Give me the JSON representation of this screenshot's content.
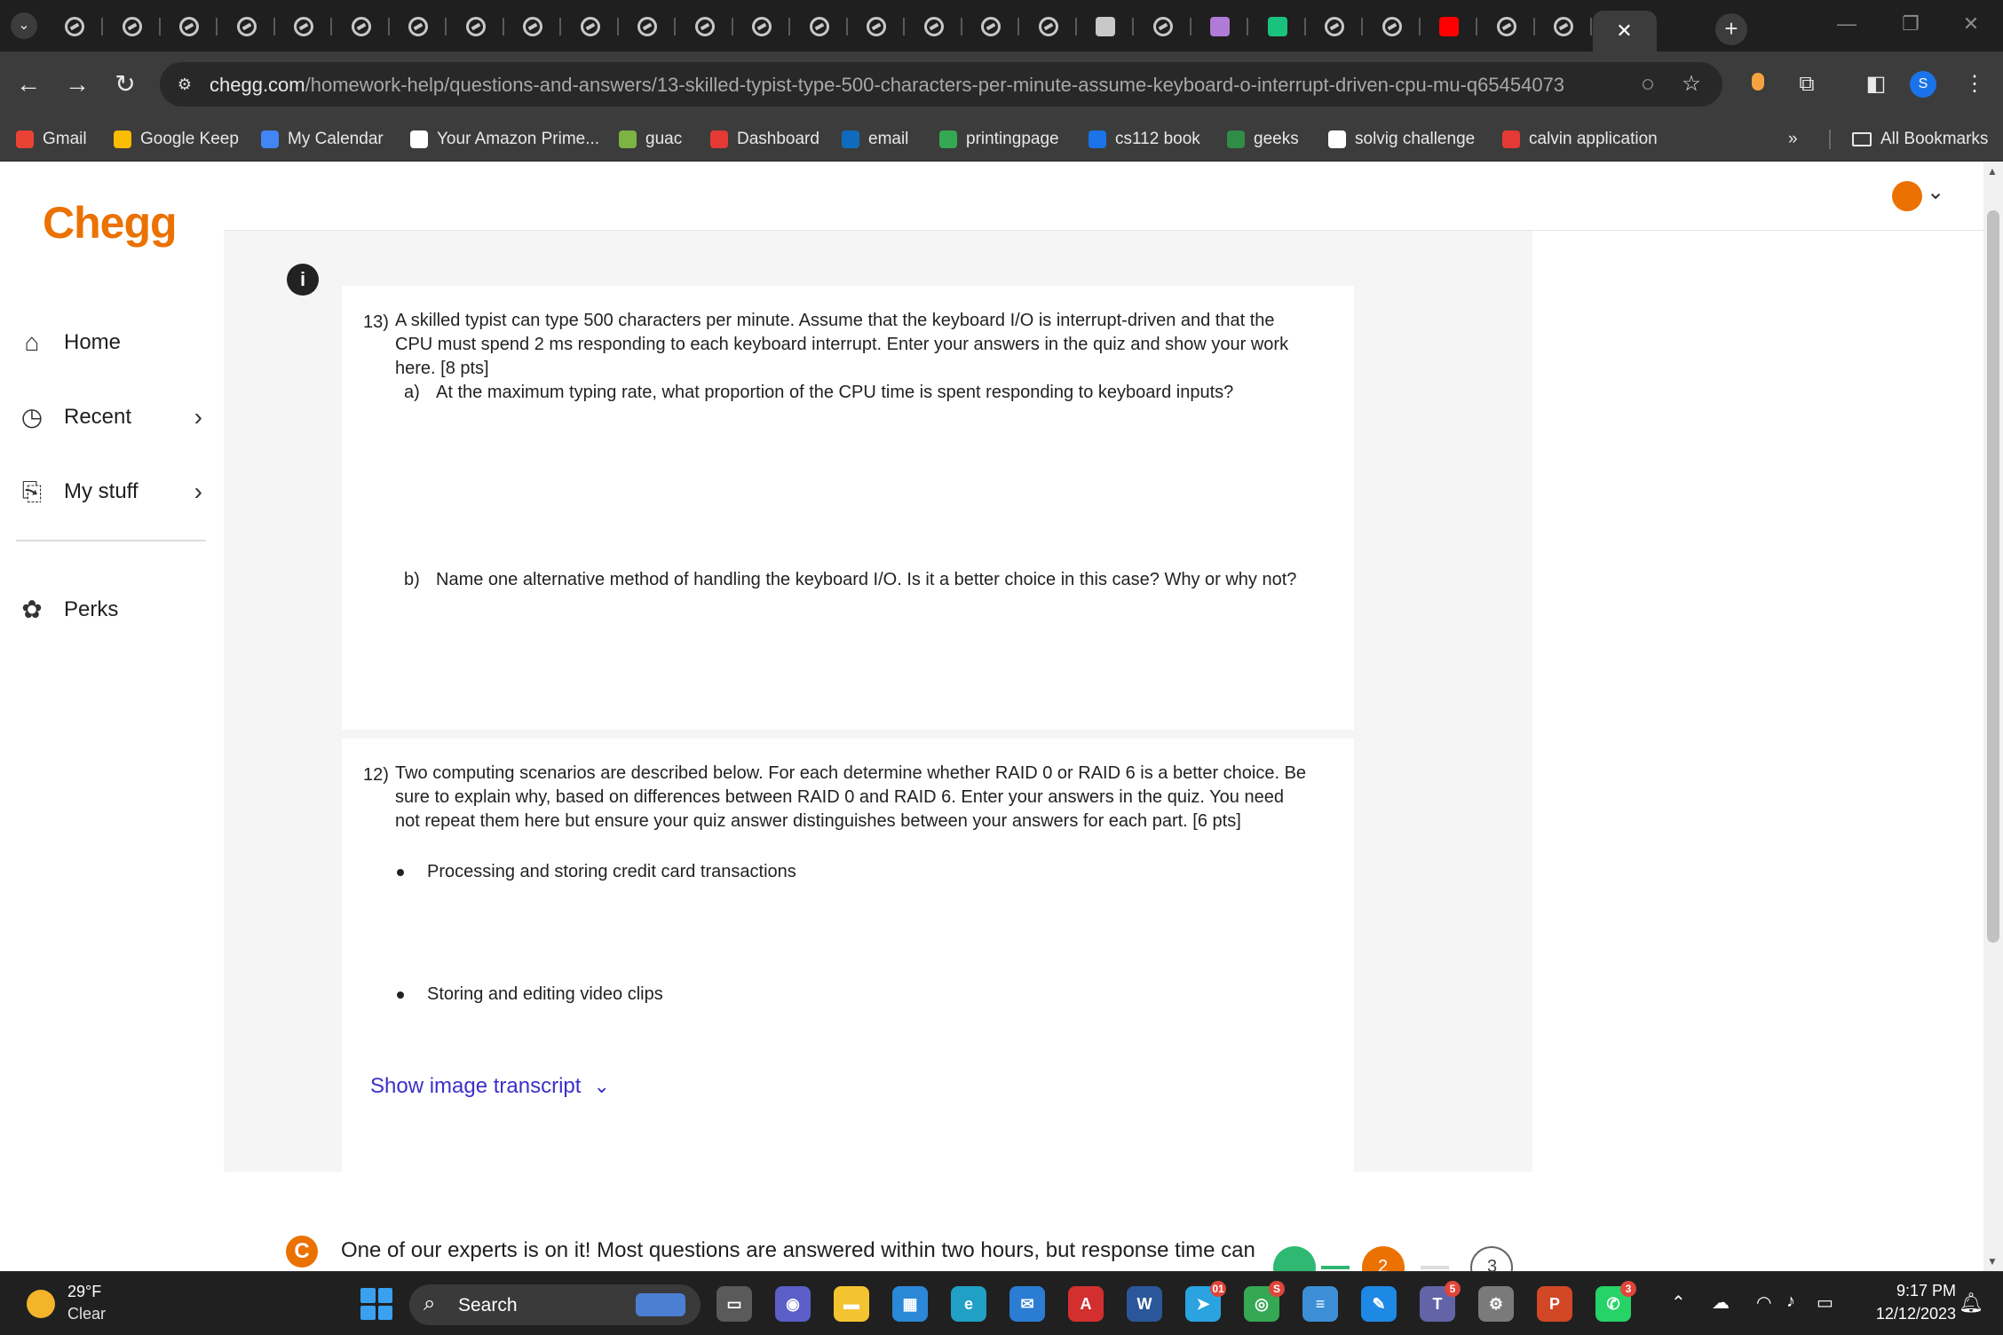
{
  "browser": {
    "tab_count": 27,
    "active_tab_close": "✕",
    "new_tab": "+",
    "url_host": "chegg.com",
    "url_path": "/homework-help/questions-and-answers/13-skilled-typist-type-500-characters-per-minute-assume-keyboard-o-interrupt-driven-cpu-mu-q65454073",
    "profile_initial": "S",
    "bookmarks": [
      {
        "label": "Gmail",
        "icon": "gmail-icon",
        "color": "#ea4335"
      },
      {
        "label": "Google Keep",
        "icon": "keep-icon",
        "color": "#fbbc04"
      },
      {
        "label": "My Calendar",
        "icon": "calendar-icon",
        "color": "#4285f4"
      },
      {
        "label": "Your Amazon Prime...",
        "icon": "amazon-icon",
        "color": "#ffffff"
      },
      {
        "label": "guac",
        "icon": "bowl-icon",
        "color": "#7cb342"
      },
      {
        "label": "Dashboard",
        "icon": "shield-icon",
        "color": "#e53935"
      },
      {
        "label": "email",
        "icon": "outlook-icon",
        "color": "#0f6cbd"
      },
      {
        "label": "printingpage",
        "icon": "flag-icon",
        "color": "#34a853"
      },
      {
        "label": "cs112 book",
        "icon": "book-icon",
        "color": "#1a73e8"
      },
      {
        "label": "geeks",
        "icon": "geeks-icon",
        "color": "#2f8d46"
      },
      {
        "label": "solvig challenge",
        "icon": "grid-icon",
        "color": "#ffffff"
      },
      {
        "label": "calvin application",
        "icon": "shield-icon",
        "color": "#e53935"
      }
    ],
    "bookmarks_overflow": "»",
    "all_bookmarks": "All Bookmarks"
  },
  "sidebar": {
    "logo": "Chegg",
    "items": [
      {
        "label": "Home",
        "icon": "home-icon",
        "has_chevron": false
      },
      {
        "label": "Recent",
        "icon": "clock-icon",
        "has_chevron": true
      },
      {
        "label": "My stuff",
        "icon": "bookmark-icon",
        "has_chevron": true
      },
      {
        "label": "Perks",
        "icon": "gift-icon",
        "has_chevron": false
      }
    ]
  },
  "question1": {
    "number": "13)",
    "lines": [
      "A skilled typist can type 500 characters per minute.  Assume that the keyboard I/O is interrupt-driven and that the",
      "CPU must spend 2 ms responding to each keyboard interrupt.  Enter your answers in the quiz and show your work",
      "here. [8 pts]"
    ],
    "part_a_label": "a)",
    "part_a": "At the maximum typing rate, what proportion of the CPU time is spent responding to keyboard inputs?",
    "part_b_label": "b)",
    "part_b": "Name one alternative method of handling the keyboard I/O.  Is it a better choice in this case?  Why or why not?"
  },
  "question2": {
    "number": "12)",
    "lines": [
      "Two computing scenarios are described below.  For each determine whether RAID 0 or RAID 6 is a better choice.  Be",
      "sure to explain why, based on differences between RAID 0 and RAID 6.  Enter your answers in the quiz.  You need",
      "not repeat them here but ensure your quiz answer distinguishes between your answers for each part. [6 pts]"
    ],
    "bullets": [
      "Processing and storing credit card transactions",
      "Storing and editing video clips"
    ]
  },
  "transcript_label": "Show image transcript",
  "expert_message": "One of our experts is on it! Most questions are answered within two hours, but response time can",
  "progress_steps": [
    "",
    "2",
    "3"
  ],
  "taskbar": {
    "temperature": "29°F",
    "weather": "Clear",
    "search_label": "Search",
    "apps": [
      {
        "name": "taskview-icon",
        "color": "#5a5a5a",
        "glyph": "▭",
        "badge": ""
      },
      {
        "name": "meet-icon",
        "color": "#5b5fc7",
        "glyph": "◉",
        "badge": ""
      },
      {
        "name": "file-explorer-icon",
        "color": "#f4c430",
        "glyph": "▬",
        "badge": ""
      },
      {
        "name": "store-icon",
        "color": "#2b88d8",
        "glyph": "▦",
        "badge": ""
      },
      {
        "name": "edge-icon",
        "color": "#1fa0c4",
        "glyph": "e",
        "badge": ""
      },
      {
        "name": "mail-icon",
        "color": "#2b7cd3",
        "glyph": "✉",
        "badge": ""
      },
      {
        "name": "pdf-icon",
        "color": "#d32f2f",
        "glyph": "A",
        "badge": ""
      },
      {
        "name": "word-icon",
        "color": "#2b579a",
        "glyph": "W",
        "badge": ""
      },
      {
        "name": "telegram-icon",
        "color": "#2aa3e0",
        "glyph": "➤",
        "badge": "01"
      },
      {
        "name": "chrome-icon",
        "color": "#34a853",
        "glyph": "◎",
        "badge": "S"
      },
      {
        "name": "notepad-icon",
        "color": "#3c8fd6",
        "glyph": "≡",
        "badge": ""
      },
      {
        "name": "paint-icon",
        "color": "#1e88e5",
        "glyph": "✎",
        "badge": ""
      },
      {
        "name": "teams-icon",
        "color": "#6264a7",
        "glyph": "T",
        "badge": "5"
      },
      {
        "name": "settings-icon",
        "color": "#7a7a7a",
        "glyph": "⚙",
        "badge": ""
      },
      {
        "name": "powerpoint-icon",
        "color": "#d24726",
        "glyph": "P",
        "badge": ""
      },
      {
        "name": "whatsapp-icon",
        "color": "#25d366",
        "glyph": "✆",
        "badge": "3"
      }
    ],
    "time": "9:17 PM",
    "date": "12/12/2023"
  }
}
